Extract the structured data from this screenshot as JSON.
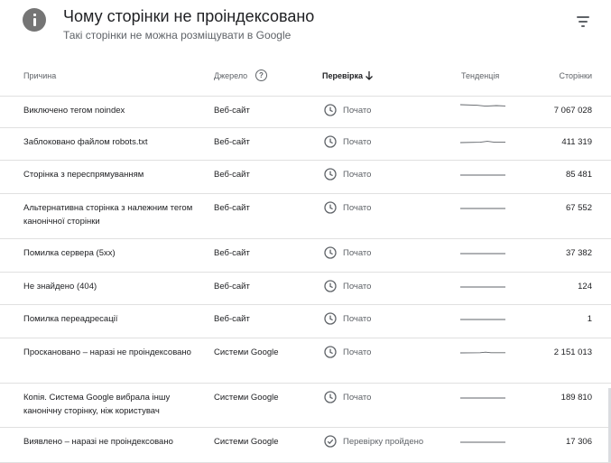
{
  "header": {
    "icon": "info-icon",
    "title": "Чому сторінки не проіндексовано",
    "subtitle": "Такі сторінки не можна розміщувати в Google",
    "filter_icon": "filter-icon"
  },
  "table": {
    "columns": {
      "reason": "Причина",
      "source": "Джерело",
      "validation": "Перевірка",
      "trend": "Тенденція",
      "pages": "Сторінки"
    },
    "sorted_by": "validation",
    "rows": [
      {
        "reason": "Виключено тегом noindex",
        "source": "Веб-сайт",
        "status": "Почато",
        "status_icon": "clock-icon",
        "pages": "7 067 028"
      },
      {
        "reason": "Заблоковано файлом robots.txt",
        "source": "Веб-сайт",
        "status": "Почато",
        "status_icon": "clock-icon",
        "pages": "411 319"
      },
      {
        "reason": "Сторінка з переспрямуванням",
        "source": "Веб-сайт",
        "status": "Почато",
        "status_icon": "clock-icon",
        "pages": "85 481"
      },
      {
        "reason": "Альтернативна сторінка з належним тегом канонічної сторінки",
        "source": "Веб-сайт",
        "status": "Почато",
        "status_icon": "clock-icon",
        "pages": "67 552"
      },
      {
        "reason": "Помилка сервера (5xx)",
        "source": "Веб-сайт",
        "status": "Почато",
        "status_icon": "clock-icon",
        "pages": "37 382"
      },
      {
        "reason": "Не знайдено (404)",
        "source": "Веб-сайт",
        "status": "Почато",
        "status_icon": "clock-icon",
        "pages": "124"
      },
      {
        "reason": "Помилка переадресації",
        "source": "Веб-сайт",
        "status": "Почато",
        "status_icon": "clock-icon",
        "pages": "1"
      },
      {
        "reason": "Проскановано – наразі не проіндексовано",
        "source": "Системи Google",
        "status": "Почато",
        "status_icon": "clock-icon",
        "pages": "2 151 013"
      },
      {
        "reason": "Копія. Система Google вибрала іншу канонічну сторінку, ніж користувач",
        "source": "Системи Google",
        "status": "Почато",
        "status_icon": "clock-icon",
        "pages": "189 810"
      },
      {
        "reason": "Виявлено – наразі не проіндексовано",
        "source": "Системи Google",
        "status": "Перевірку пройдено",
        "status_icon": "check-circle-icon",
        "pages": "17 306"
      }
    ]
  }
}
